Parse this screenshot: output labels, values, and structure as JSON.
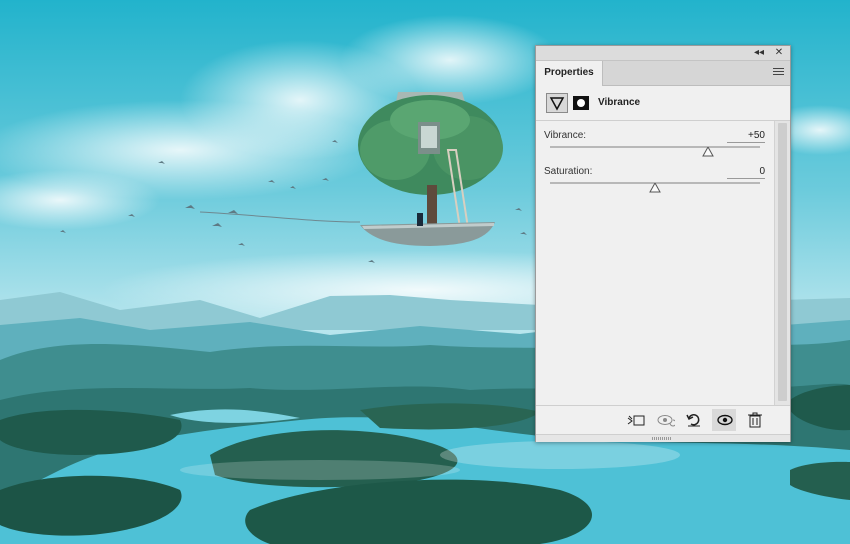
{
  "panel": {
    "collapse_glyph": "◂◂",
    "close_glyph": "✕",
    "tab_label": "Properties",
    "menu_icon": "panel-menu-icon",
    "adjustment_name": "Vibrance"
  },
  "controls": [
    {
      "label": "Vibrance:",
      "value": "+50",
      "level_fraction": 0.75
    },
    {
      "label": "Saturation:",
      "value": "0",
      "level_fraction": 0.5
    }
  ],
  "footer_icons": [
    "clip-to-layer-icon",
    "view-previous-state-icon",
    "reset-icon",
    "visibility-eye-icon",
    "trash-icon"
  ],
  "colors": {
    "panel_bg": "#f0f0f0",
    "sky": "#2fb7cf",
    "water": "#4ec1d6",
    "land": "#1f5a4c"
  }
}
